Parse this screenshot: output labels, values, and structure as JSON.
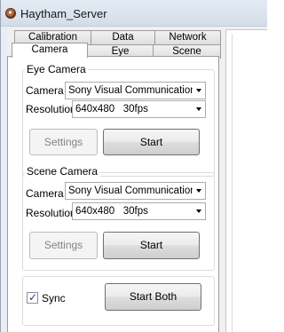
{
  "window": {
    "title": "Haytham_Server",
    "icon": "haytham-app-icon"
  },
  "tabs": {
    "top_row": [
      "Calibration",
      "Data",
      "Network"
    ],
    "bottom_row": [
      "Camera",
      "Eye",
      "Scene"
    ],
    "active": "Camera"
  },
  "eye_camera": {
    "group_title": "Eye Camera",
    "camera_label": "Camera",
    "camera_value": "Sony Visual Communication Car",
    "resolution_label": "Resolution",
    "resolution_value": "640x480   30fps",
    "settings_label": "Settings",
    "start_label": "Start"
  },
  "scene_camera": {
    "group_title": "Scene Camera",
    "camera_label": "Camera",
    "camera_value": "Sony Visual Communication Car",
    "resolution_label": "Resolution",
    "resolution_value": "640x480   30fps",
    "settings_label": "Settings",
    "start_label": "Start"
  },
  "sync": {
    "label": "Sync",
    "checked": true,
    "start_both_label": "Start Both"
  }
}
